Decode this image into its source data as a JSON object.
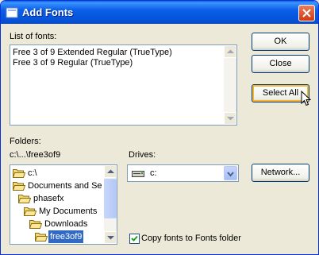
{
  "window": {
    "title": "Add Fonts"
  },
  "fonts": {
    "label": "List of fonts:",
    "items": [
      "Free 3 of 9 Extended Regular (TrueType)",
      "Free 3 of 9 Regular (TrueType)"
    ]
  },
  "buttons": {
    "ok": "OK",
    "close": "Close",
    "select_all": "Select All",
    "network": "Network..."
  },
  "folders": {
    "label": "Folders:",
    "path": "c:\\...\\free3of9",
    "items": [
      {
        "label": "c:\\",
        "icon": "open-folder-icon"
      },
      {
        "label": "Documents and Se",
        "icon": "open-folder-icon"
      },
      {
        "label": "phasefx",
        "icon": "open-folder-icon"
      },
      {
        "label": "My Documents",
        "icon": "open-folder-icon"
      },
      {
        "label": "Downloads",
        "icon": "open-folder-icon"
      },
      {
        "label": "free3of9",
        "icon": "open-folder-icon",
        "selected": true
      }
    ]
  },
  "drives": {
    "label": "Drives:",
    "selected": "c:",
    "icon": "hard-drive-icon"
  },
  "copy_option": {
    "label": "Copy fonts to Fonts folder",
    "checked": true
  },
  "colors": {
    "titlebar": "#0a5fe8",
    "selection": "#316ac5",
    "dialog_bg": "#ece9d8"
  }
}
